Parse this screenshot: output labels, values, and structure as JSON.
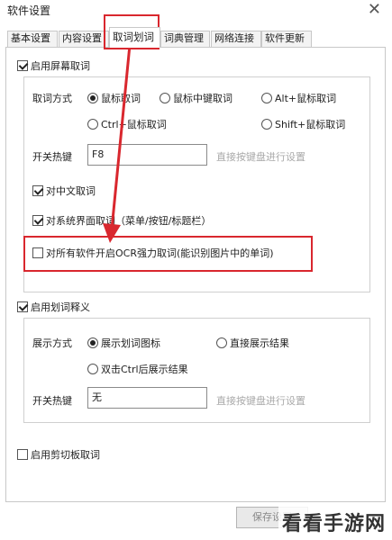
{
  "window": {
    "title": "软件设置"
  },
  "tabs": [
    {
      "label": "基本设置",
      "active": false
    },
    {
      "label": "内容设置",
      "active": false
    },
    {
      "label": "取词划词",
      "active": true
    },
    {
      "label": "词典管理",
      "active": false
    },
    {
      "label": "网络连接",
      "active": false
    },
    {
      "label": "软件更新",
      "active": false
    }
  ],
  "screen_capture": {
    "enable_label": "启用屏幕取词",
    "enabled": true,
    "method_label": "取词方式",
    "methods": [
      {
        "label": "鼠标取词",
        "checked": true
      },
      {
        "label": "鼠标中键取词",
        "checked": false
      },
      {
        "label": "Alt+鼠标取词",
        "checked": false
      },
      {
        "label": "Ctrl+鼠标取词",
        "checked": false
      },
      {
        "label": "Shift+鼠标取词",
        "checked": false
      }
    ],
    "hotkey_label": "开关热键",
    "hotkey_value": "F8",
    "hotkey_hint": "直接按键盘进行设置",
    "chinese_label": "对中文取词",
    "chinese_checked": true,
    "ui_label": "对系统界面取词（菜单/按钮/标题栏）",
    "ui_checked": true,
    "ocr_label": "对所有软件开启OCR强力取词(能识别图片中的单词)",
    "ocr_checked": false
  },
  "selection_translate": {
    "enable_label": "启用划词释义",
    "enabled": true,
    "mode_label": "展示方式",
    "modes": [
      {
        "label": "展示划词图标",
        "checked": true
      },
      {
        "label": "直接展示结果",
        "checked": false
      },
      {
        "label": "双击Ctrl后展示结果",
        "checked": false
      }
    ],
    "hotkey_label": "开关热键",
    "hotkey_value": "无",
    "hotkey_hint": "直接按键盘进行设置"
  },
  "clipboard": {
    "enable_label": "启用剪切板取词",
    "enabled": false
  },
  "footer": {
    "save_label": "保存设置"
  },
  "watermark": "看看手游网",
  "colors": {
    "highlight": "#d9272e"
  }
}
